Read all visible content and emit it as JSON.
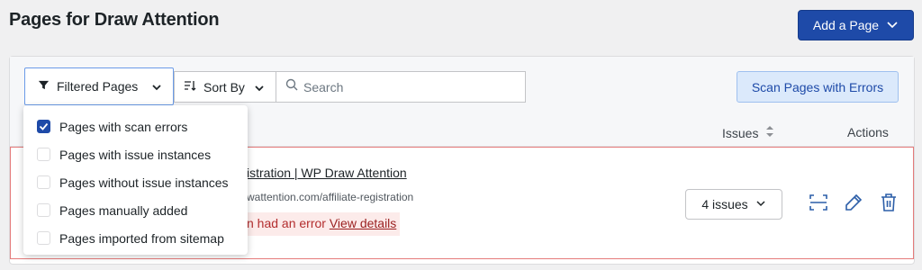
{
  "page": {
    "title": "Pages for Draw Attention"
  },
  "header": {
    "add_page_label": "Add a Page"
  },
  "toolbar": {
    "filter_label": "Filtered Pages",
    "sort_label": "Sort By",
    "search_placeholder": "Search",
    "search_value": "",
    "scan_label": "Scan Pages with Errors"
  },
  "table": {
    "col_issues": "Issues",
    "col_actions": "Actions"
  },
  "row": {
    "title": "istration | WP Draw Attention",
    "url": "wattention.com/affiliate-registration",
    "error_text": "n had an error",
    "error_link": "View details",
    "issues_label": "4 issues"
  },
  "dropdown": {
    "items": [
      {
        "label": "Pages with scan errors",
        "checked": true
      },
      {
        "label": "Pages with issue instances",
        "checked": false
      },
      {
        "label": "Pages without issue instances",
        "checked": false
      },
      {
        "label": "Pages manually added",
        "checked": false
      },
      {
        "label": "Pages imported from sitemap",
        "checked": false
      }
    ]
  },
  "colors": {
    "primary": "#1e4aa8",
    "error": "#b32d2e",
    "error_bg": "#fcebea",
    "row_border": "#e57b7b"
  }
}
